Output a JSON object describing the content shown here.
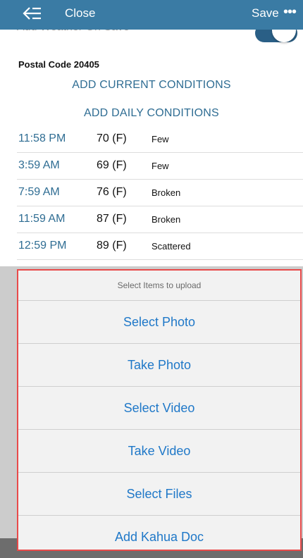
{
  "nav": {
    "close_label": "Close",
    "save_label": "Save",
    "more_label": "•••"
  },
  "weather_setting": {
    "label": "Add Weather On Save",
    "toggle_on": true
  },
  "postal": {
    "label": "Postal Code",
    "value": "20405"
  },
  "actions": {
    "current": "ADD CURRENT CONDITIONS",
    "daily": "ADD DAILY CONDITIONS"
  },
  "weather_rows": [
    {
      "time": "11:58 PM",
      "temp": "70 (F)",
      "cond": "Few"
    },
    {
      "time": "3:59 AM",
      "temp": "69 (F)",
      "cond": "Few"
    },
    {
      "time": "7:59 AM",
      "temp": "76 (F)",
      "cond": "Broken"
    },
    {
      "time": "11:59 AM",
      "temp": "87 (F)",
      "cond": "Broken"
    },
    {
      "time": "12:59 PM",
      "temp": "89 (F)",
      "cond": "Scattered"
    }
  ],
  "sheet": {
    "title": "Select Items to upload",
    "items": [
      {
        "label": "Select Photo"
      },
      {
        "label": "Take Photo"
      },
      {
        "label": "Select Video"
      },
      {
        "label": "Take Video"
      },
      {
        "label": "Select Files"
      },
      {
        "label": "Add Kahua Doc"
      }
    ]
  },
  "colors": {
    "nav_bg": "#3a7ba4",
    "link": "#2f6d93",
    "sheet_action": "#1f78c8",
    "highlight": "#e84a4a"
  }
}
